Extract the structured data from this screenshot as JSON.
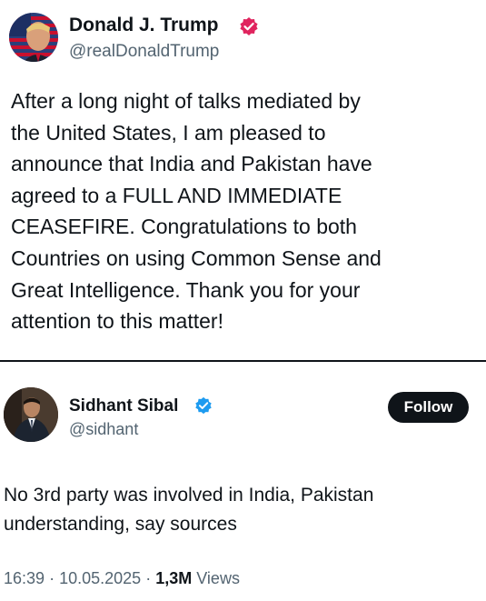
{
  "quoted_tweet": {
    "author_name": "Donald J. Trump",
    "handle": "@realDonaldTrump",
    "avatar_icon": "flag-portrait-avatar",
    "badge_icon": "verified-badge-icon",
    "badge_color": "#e0245e",
    "text": "After a long night of talks mediated by\nthe United States, I am pleased to\nannounce that India and Pakistan have\nagreed to a FULL AND IMMEDIATE\nCEASEFIRE. Congratulations to both\nCountries on using Common Sense and\nGreat Intelligence. Thank you for your\nattention to this matter!"
  },
  "reply_tweet": {
    "author_name": "Sidhant Sibal",
    "handle": "@sidhant",
    "avatar_icon": "portrait-avatar",
    "badge_icon": "verified-badge-icon",
    "badge_color": "#1d9bf0",
    "follow_label": "Follow",
    "text": "No 3rd party was involved in India, Pakistan\nunderstanding, say sources",
    "time": "16:39",
    "date": "10.05.2025",
    "views_count": "1,3M",
    "views_label": "Views",
    "separator": "·"
  }
}
